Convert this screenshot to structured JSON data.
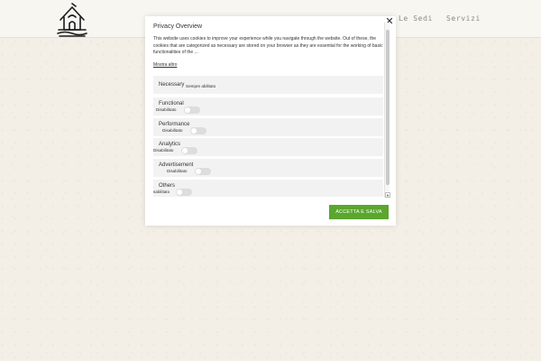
{
  "site": {
    "nav": [
      {
        "label": "Le Sedi"
      },
      {
        "label": "Servizi"
      }
    ],
    "logo_icon": "hut-logo-icon"
  },
  "modal": {
    "title": "Privacy Overview",
    "description": "This website uses cookies to improve your experience while you navigate through the website. Out of these, the cookies that are categorized as necessary are stored on your browser as they are essential for the working of basic functionalities of the ...",
    "show_more": "Mostra altro",
    "close_icon": "close-icon",
    "close_glyph": "✕",
    "categories": [
      {
        "name": "Necessary",
        "status": "Sempre abilitato"
      },
      {
        "name": "Functional",
        "status": "Disabilitato"
      },
      {
        "name": "Performance",
        "status": "Disabilitato"
      },
      {
        "name": "Analytics",
        "status": "Disabilitato"
      },
      {
        "name": "Advertisement",
        "status": "Disabilitato"
      },
      {
        "name": "Others",
        "status": "sabilitato"
      }
    ],
    "accept_button": "ACCETTA E SALVA",
    "accent_color": "#5ba62e"
  }
}
